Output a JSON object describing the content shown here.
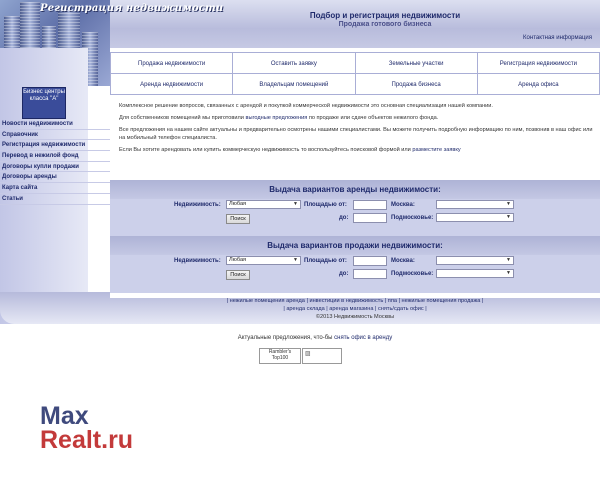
{
  "header": {
    "site_title": "Регистрация недвижимости",
    "line1": "Подбор и регистрация недвижимости",
    "line2": "Продажа готового бизнеса",
    "contact_link": "Контактная информация"
  },
  "promo": {
    "text": "Бизнес центры класса \"А\""
  },
  "sidebar": {
    "items": [
      {
        "label": "Новости недвижимости"
      },
      {
        "label": "Справочник"
      },
      {
        "label": "Регистрация недвижимости"
      },
      {
        "label": "Перевод в нежилой фонд"
      },
      {
        "label": "Договоры купли продажи"
      },
      {
        "label": "Договоры аренды"
      },
      {
        "label": "Карта сайта"
      },
      {
        "label": "Статьи"
      }
    ]
  },
  "nav": {
    "row1": [
      "Продажа недвижимости",
      "Оставить заявку",
      "Земельные участки",
      "Регистрация недвижимости"
    ],
    "row2": [
      "Аренда недвижимости",
      "Владельцам помещений",
      "Продажа бизнеса",
      "Аренда офиса"
    ]
  },
  "intro": {
    "p1": "Комплексное решение вопросов, связанных с арендой и покупкой коммерческой недвижимости это основная специализация нашей компании.",
    "p2_before": "Для собственников помещений мы приготовили ",
    "p2_link": "выгодные предложения",
    "p2_after": " по продаже или сдаче объектов нежилого фонда.",
    "p3": "Все предложения на нашем сайте актуальны и предварительно осмотрены нашими специалистами. Вы можете получить подробную информацию по ним, позвонив в наш офис или на мобильный телефон специалиста.",
    "p4_before": "Если Вы хотите арендовать или купить коммерческую недвижимость то воспользуйтесь поисковой формой или ",
    "p4_link": "разместите заявку"
  },
  "search_rent": {
    "title": "Выдача вариантов аренды недвижимости:",
    "property_label": "Недвижимость:",
    "property_value": "Любая",
    "area_from_label": "Площадью от:",
    "area_to_label": "до:",
    "moscow_label": "Москва:",
    "region_label": "Подмосковье:",
    "search_button": "Поиск"
  },
  "search_sale": {
    "title": "Выдача вариантов продажи недвижимости:",
    "property_label": "Недвижимость:",
    "property_value": "Любая",
    "area_from_label": "Площадью от:",
    "area_to_label": "до:",
    "moscow_label": "Москва:",
    "region_label": "Подмосковье:",
    "search_button": "Поиск"
  },
  "footer": {
    "line1": "| нежилые помещения аренда | инвестиции в недвижимость | ппа | нежилые помещения продажа |",
    "line2": "| аренда склада | аренда магазина | снять/сдать офис |",
    "copyright": "©2013 Недвижимость Москвы"
  },
  "offer": {
    "before": "Актуальные предложения, что-бы ",
    "link": "снять офис в аренду"
  },
  "counter": {
    "text": "Rambler's Top100"
  },
  "watermark": {
    "line1": "Max",
    "line2": "Realt.ru"
  }
}
